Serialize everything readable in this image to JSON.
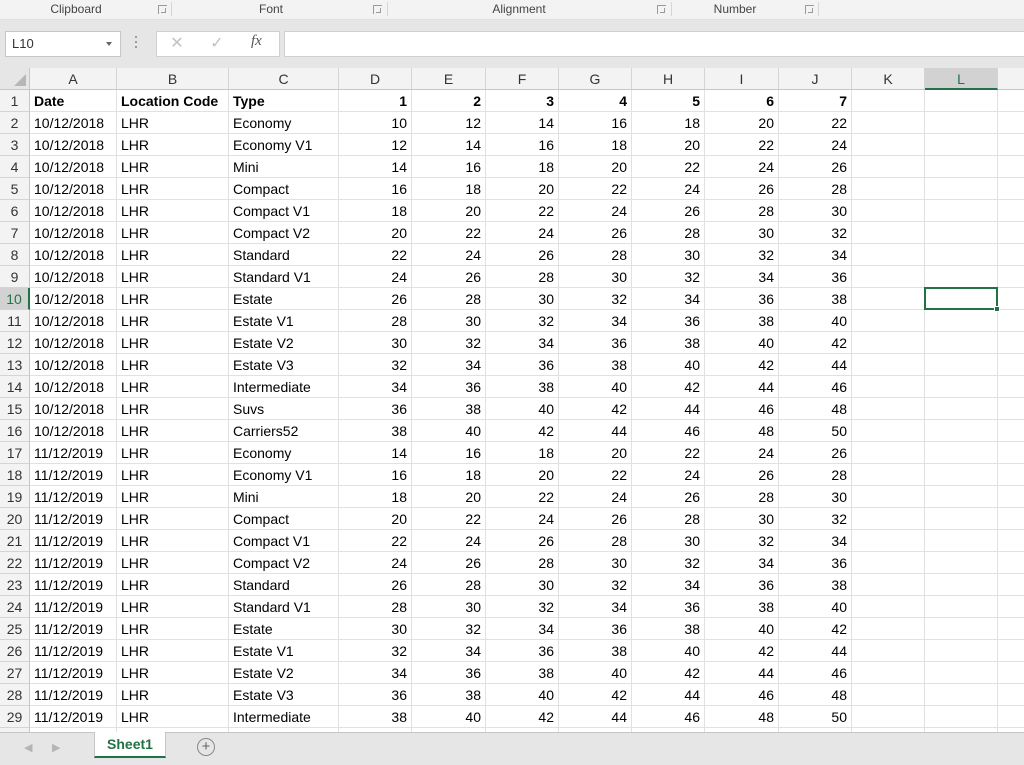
{
  "ribbon": {
    "groups": [
      "Clipboard",
      "Font",
      "Alignment",
      "Number"
    ]
  },
  "formula_bar": {
    "name_box": "L10",
    "cancel_icon": "✕",
    "enter_icon": "✓",
    "fx_label": "fx",
    "formula": ""
  },
  "grid": {
    "columns": [
      "A",
      "B",
      "C",
      "D",
      "E",
      "F",
      "G",
      "H",
      "I",
      "J",
      "K",
      "L"
    ],
    "active_cell": "L10",
    "active_column": "L",
    "active_row": 10,
    "header_row": [
      "Date",
      "Location Code",
      "Type",
      "1",
      "2",
      "3",
      "4",
      "5",
      "6",
      "7"
    ],
    "rows": [
      [
        "10/12/2018",
        "LHR",
        "Economy",
        10,
        12,
        14,
        16,
        18,
        20,
        22
      ],
      [
        "10/12/2018",
        "LHR",
        "Economy V1",
        12,
        14,
        16,
        18,
        20,
        22,
        24
      ],
      [
        "10/12/2018",
        "LHR",
        "Mini",
        14,
        16,
        18,
        20,
        22,
        24,
        26
      ],
      [
        "10/12/2018",
        "LHR",
        "Compact",
        16,
        18,
        20,
        22,
        24,
        26,
        28
      ],
      [
        "10/12/2018",
        "LHR",
        "Compact V1",
        18,
        20,
        22,
        24,
        26,
        28,
        30
      ],
      [
        "10/12/2018",
        "LHR",
        "Compact V2",
        20,
        22,
        24,
        26,
        28,
        30,
        32
      ],
      [
        "10/12/2018",
        "LHR",
        "Standard",
        22,
        24,
        26,
        28,
        30,
        32,
        34
      ],
      [
        "10/12/2018",
        "LHR",
        "Standard V1",
        24,
        26,
        28,
        30,
        32,
        34,
        36
      ],
      [
        "10/12/2018",
        "LHR",
        "Estate",
        26,
        28,
        30,
        32,
        34,
        36,
        38
      ],
      [
        "10/12/2018",
        "LHR",
        "Estate V1",
        28,
        30,
        32,
        34,
        36,
        38,
        40
      ],
      [
        "10/12/2018",
        "LHR",
        "Estate V2",
        30,
        32,
        34,
        36,
        38,
        40,
        42
      ],
      [
        "10/12/2018",
        "LHR",
        "Estate V3",
        32,
        34,
        36,
        38,
        40,
        42,
        44
      ],
      [
        "10/12/2018",
        "LHR",
        "Intermediate",
        34,
        36,
        38,
        40,
        42,
        44,
        46
      ],
      [
        "10/12/2018",
        "LHR",
        "Suvs",
        36,
        38,
        40,
        42,
        44,
        46,
        48
      ],
      [
        "10/12/2018",
        "LHR",
        "Carriers52",
        38,
        40,
        42,
        44,
        46,
        48,
        50
      ],
      [
        "11/12/2019",
        "LHR",
        "Economy",
        14,
        16,
        18,
        20,
        22,
        24,
        26
      ],
      [
        "11/12/2019",
        "LHR",
        "Economy V1",
        16,
        18,
        20,
        22,
        24,
        26,
        28
      ],
      [
        "11/12/2019",
        "LHR",
        "Mini",
        18,
        20,
        22,
        24,
        26,
        28,
        30
      ],
      [
        "11/12/2019",
        "LHR",
        "Compact",
        20,
        22,
        24,
        26,
        28,
        30,
        32
      ],
      [
        "11/12/2019",
        "LHR",
        "Compact V1",
        22,
        24,
        26,
        28,
        30,
        32,
        34
      ],
      [
        "11/12/2019",
        "LHR",
        "Compact V2",
        24,
        26,
        28,
        30,
        32,
        34,
        36
      ],
      [
        "11/12/2019",
        "LHR",
        "Standard",
        26,
        28,
        30,
        32,
        34,
        36,
        38
      ],
      [
        "11/12/2019",
        "LHR",
        "Standard V1",
        28,
        30,
        32,
        34,
        36,
        38,
        40
      ],
      [
        "11/12/2019",
        "LHR",
        "Estate",
        30,
        32,
        34,
        36,
        38,
        40,
        42
      ],
      [
        "11/12/2019",
        "LHR",
        "Estate V1",
        32,
        34,
        36,
        38,
        40,
        42,
        44
      ],
      [
        "11/12/2019",
        "LHR",
        "Estate V2",
        34,
        36,
        38,
        40,
        42,
        44,
        46
      ],
      [
        "11/12/2019",
        "LHR",
        "Estate V3",
        36,
        38,
        40,
        42,
        44,
        46,
        48
      ],
      [
        "11/12/2019",
        "LHR",
        "Intermediate",
        38,
        40,
        42,
        44,
        46,
        48,
        50
      ]
    ]
  },
  "sheets": {
    "tabs": [
      "Sheet1"
    ],
    "active": "Sheet1",
    "add_icon": "+"
  },
  "colors": {
    "accent": "#217346"
  }
}
